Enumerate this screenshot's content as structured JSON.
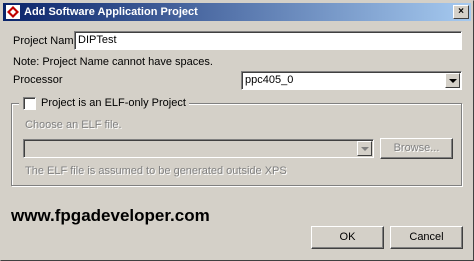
{
  "window": {
    "title": "Add Software Application Project",
    "app_icon": "xilinx-logo-icon",
    "close_label": "×"
  },
  "project_name": {
    "label": "Project Name",
    "value": "DIPTest"
  },
  "note": "Note: Project Name cannot have spaces.",
  "processor": {
    "label": "Processor",
    "selected": "ppc405_0"
  },
  "elf_group": {
    "checkbox_label": "Project is an ELF-only Project",
    "checked": false,
    "choose_label": "Choose an ELF file.",
    "elf_value": "",
    "browse_label": "Browse...",
    "info": "The ELF file is assumed to be generated outside XPS"
  },
  "watermark": "www.fpgadeveloper.com",
  "buttons": {
    "ok": "OK",
    "cancel": "Cancel"
  }
}
